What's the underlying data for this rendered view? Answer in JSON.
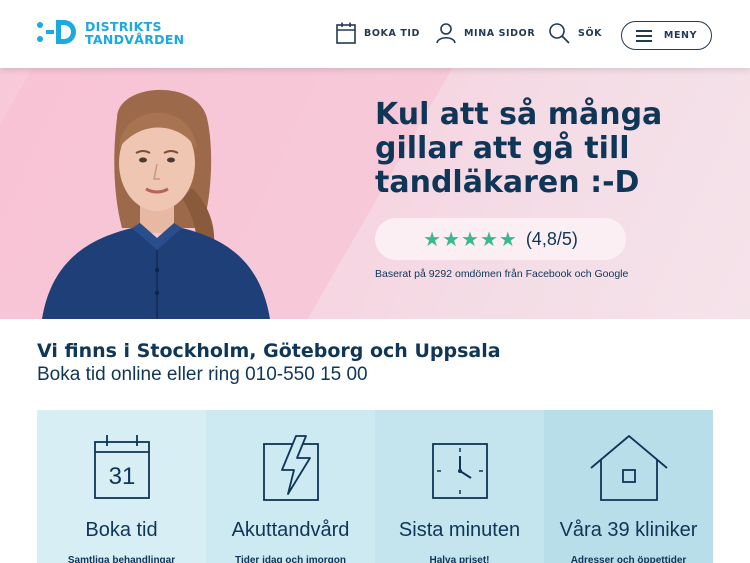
{
  "header": {
    "logo_line1": "DISTRIKTS",
    "logo_line2": "TANDVÅRDEN",
    "nav": {
      "book": "BOKA TID",
      "mine": "MINA SIDOR",
      "search": "SÖK",
      "menu": "MENY"
    }
  },
  "hero": {
    "title": "Kul att så många gillar att gå till tandläkaren :-D",
    "stars": "★★★★★",
    "rating": "(4,8/5)",
    "note": "Baserat på 9292 omdömen från Facebook och Google"
  },
  "locations": {
    "title": "Vi finns i Stockholm, Göteborg och Uppsala",
    "subtitle": "Boka tid online eller ring 010-550 15 00"
  },
  "cards": [
    {
      "title": "Boka tid",
      "subtitle": "Samtliga behandlingar",
      "icon": "calendar-icon",
      "bg": "#d7eef5",
      "calendar_day": "31"
    },
    {
      "title": "Akuttandvård",
      "subtitle": "Tider idag och imorgon",
      "icon": "lightning-icon",
      "bg": "#cde9f1"
    },
    {
      "title": "Sista minuten",
      "subtitle": "Halva priset!",
      "icon": "clock-icon",
      "bg": "#c4e5ee"
    },
    {
      "title": "Våra 39 kliniker",
      "subtitle": "Adresser och öppettider",
      "icon": "house-icon",
      "bg": "#b8dfe9"
    }
  ],
  "colors": {
    "brand_blue": "#1aa9e0",
    "navy": "#0f3557",
    "star_green": "#3cb98a",
    "hero_pink": "#f8c9d9"
  }
}
